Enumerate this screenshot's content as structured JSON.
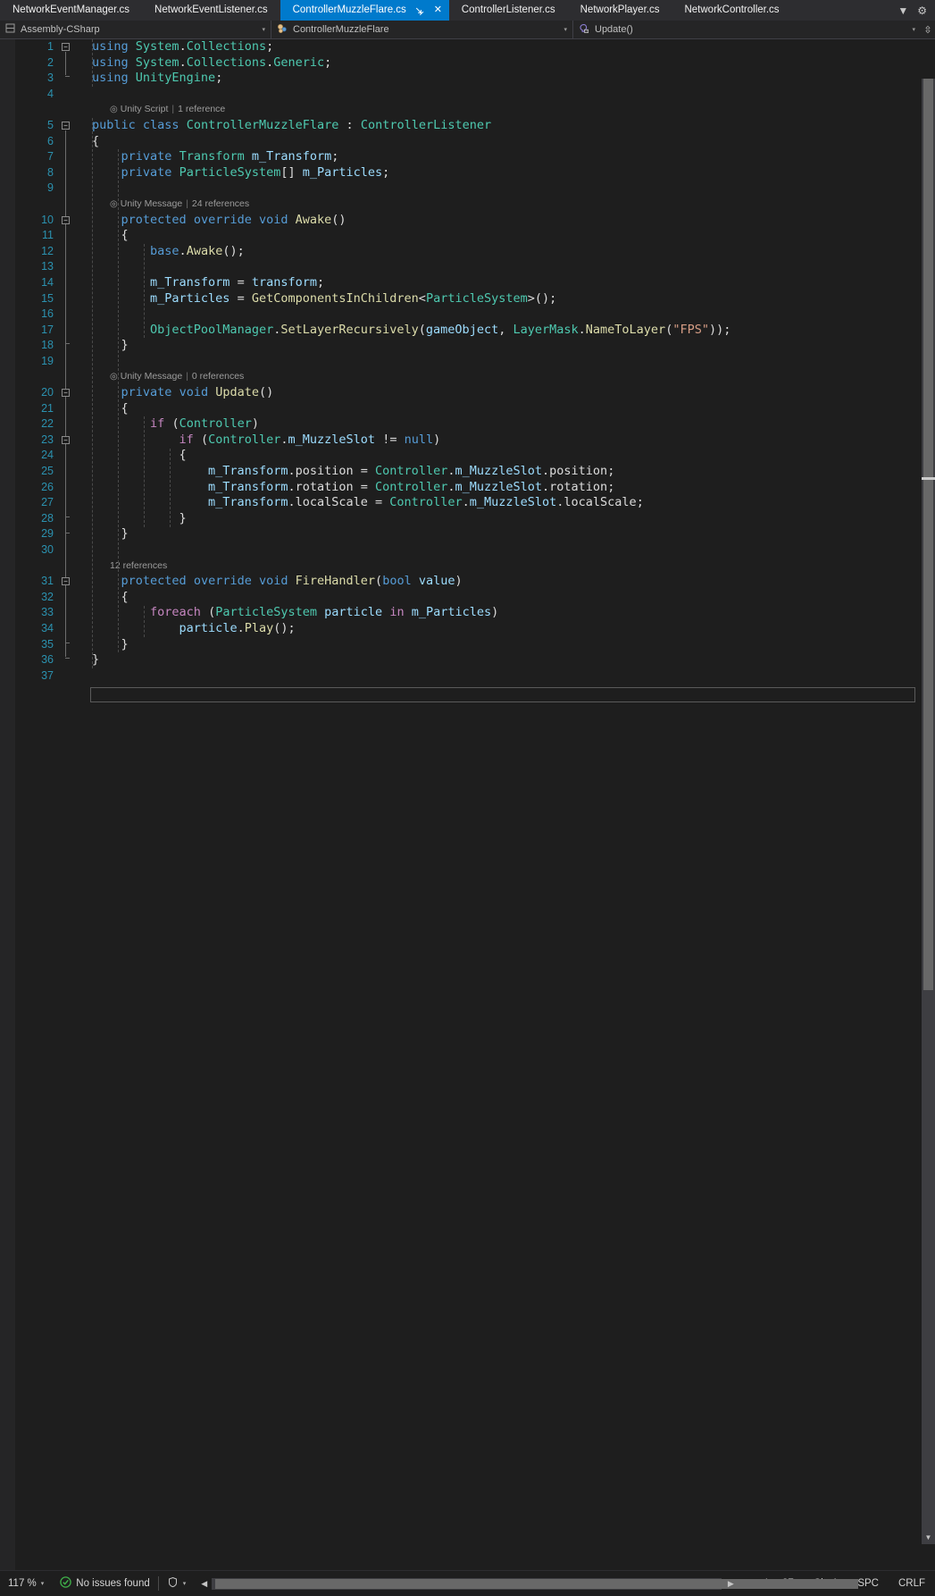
{
  "window": {
    "theme_bg": "#1e1e1e",
    "accent": "#007acc"
  },
  "tabs": {
    "items": [
      {
        "label": "NetworkEventManager.cs",
        "active": false
      },
      {
        "label": "NetworkEventListener.cs",
        "active": false
      },
      {
        "label": "ControllerMuzzleFlare.cs",
        "active": true
      },
      {
        "label": "ControllerListener.cs",
        "active": false
      },
      {
        "label": "NetworkPlayer.cs",
        "active": false
      },
      {
        "label": "NetworkController.cs",
        "active": false
      }
    ],
    "pin_glyph": "⇥",
    "close_glyph": "✕",
    "overflow_glyph": "▼",
    "config_glyph": "⚙"
  },
  "navbar": {
    "project": "Assembly-CSharp",
    "type": "ControllerMuzzleFlare",
    "member": "Update()",
    "caret_glyph": "▾",
    "split_glyph": "⇳"
  },
  "code": {
    "lines": [
      {
        "num": "1",
        "text": "using System.Collections;"
      },
      {
        "num": "2",
        "text": "using System.Collections.Generic;"
      },
      {
        "num": "3",
        "text": "using UnityEngine;"
      },
      {
        "num": "4",
        "text": ""
      },
      {
        "num": "",
        "text": "Unity Script | 1 reference",
        "hint": true
      },
      {
        "num": "5",
        "text": "public class ControllerMuzzleFlare : ControllerListener"
      },
      {
        "num": "6",
        "text": "{"
      },
      {
        "num": "7",
        "text": "    private Transform m_Transform;"
      },
      {
        "num": "8",
        "text": "    private ParticleSystem[] m_Particles;"
      },
      {
        "num": "9",
        "text": ""
      },
      {
        "num": "",
        "text": "Unity Message | 24 references",
        "hint": true
      },
      {
        "num": "10",
        "text": "    protected override void Awake()"
      },
      {
        "num": "11",
        "text": "    {"
      },
      {
        "num": "12",
        "text": "        base.Awake();"
      },
      {
        "num": "13",
        "text": ""
      },
      {
        "num": "14",
        "text": "        m_Transform = transform;"
      },
      {
        "num": "15",
        "text": "        m_Particles = GetComponentsInChildren<ParticleSystem>();"
      },
      {
        "num": "16",
        "text": ""
      },
      {
        "num": "17",
        "text": "        ObjectPoolManager.SetLayerRecursively(gameObject, LayerMask.NameToLayer(\"FPS\"));"
      },
      {
        "num": "18",
        "text": "    }"
      },
      {
        "num": "19",
        "text": ""
      },
      {
        "num": "",
        "text": "Unity Message | 0 references",
        "hint": true
      },
      {
        "num": "20",
        "text": "    private void Update()"
      },
      {
        "num": "21",
        "text": "    {"
      },
      {
        "num": "22",
        "text": "        if (Controller)"
      },
      {
        "num": "23",
        "text": "            if (Controller.m_MuzzleSlot != null)"
      },
      {
        "num": "24",
        "text": "            {"
      },
      {
        "num": "25",
        "text": "                m_Transform.position = Controller.m_MuzzleSlot.position;"
      },
      {
        "num": "26",
        "text": "                m_Transform.rotation = Controller.m_MuzzleSlot.rotation;"
      },
      {
        "num": "27",
        "text": "                m_Transform.localScale = Controller.m_MuzzleSlot.localScale;"
      },
      {
        "num": "28",
        "text": "            }"
      },
      {
        "num": "29",
        "text": "    }"
      },
      {
        "num": "30",
        "text": ""
      },
      {
        "num": "",
        "text": "12 references",
        "hint": true
      },
      {
        "num": "31",
        "text": "    protected override void FireHandler(bool value)"
      },
      {
        "num": "32",
        "text": "    {"
      },
      {
        "num": "33",
        "text": "        foreach (ParticleSystem particle in m_Particles)"
      },
      {
        "num": "34",
        "text": "            particle.Play();"
      },
      {
        "num": "35",
        "text": "    }"
      },
      {
        "num": "36",
        "text": "}"
      },
      {
        "num": "37",
        "text": ""
      }
    ],
    "hints": {
      "unity_script": "Unity Script",
      "ref_1": "1 reference",
      "unity_message": "Unity Message",
      "ref_24": "24 references",
      "ref_0": "0 references",
      "ref_12": "12 references"
    }
  },
  "statusbar": {
    "zoom": "117 %",
    "zoom_caret": "▾",
    "issues": "No issues found",
    "issues_icon": "✔",
    "feedback_caret": "▾",
    "line": "Ln: 37",
    "col": "Ch: 1",
    "spaces": "SPC",
    "eol": "CRLF",
    "scroll_left": "◀",
    "scroll_right": "▶"
  }
}
